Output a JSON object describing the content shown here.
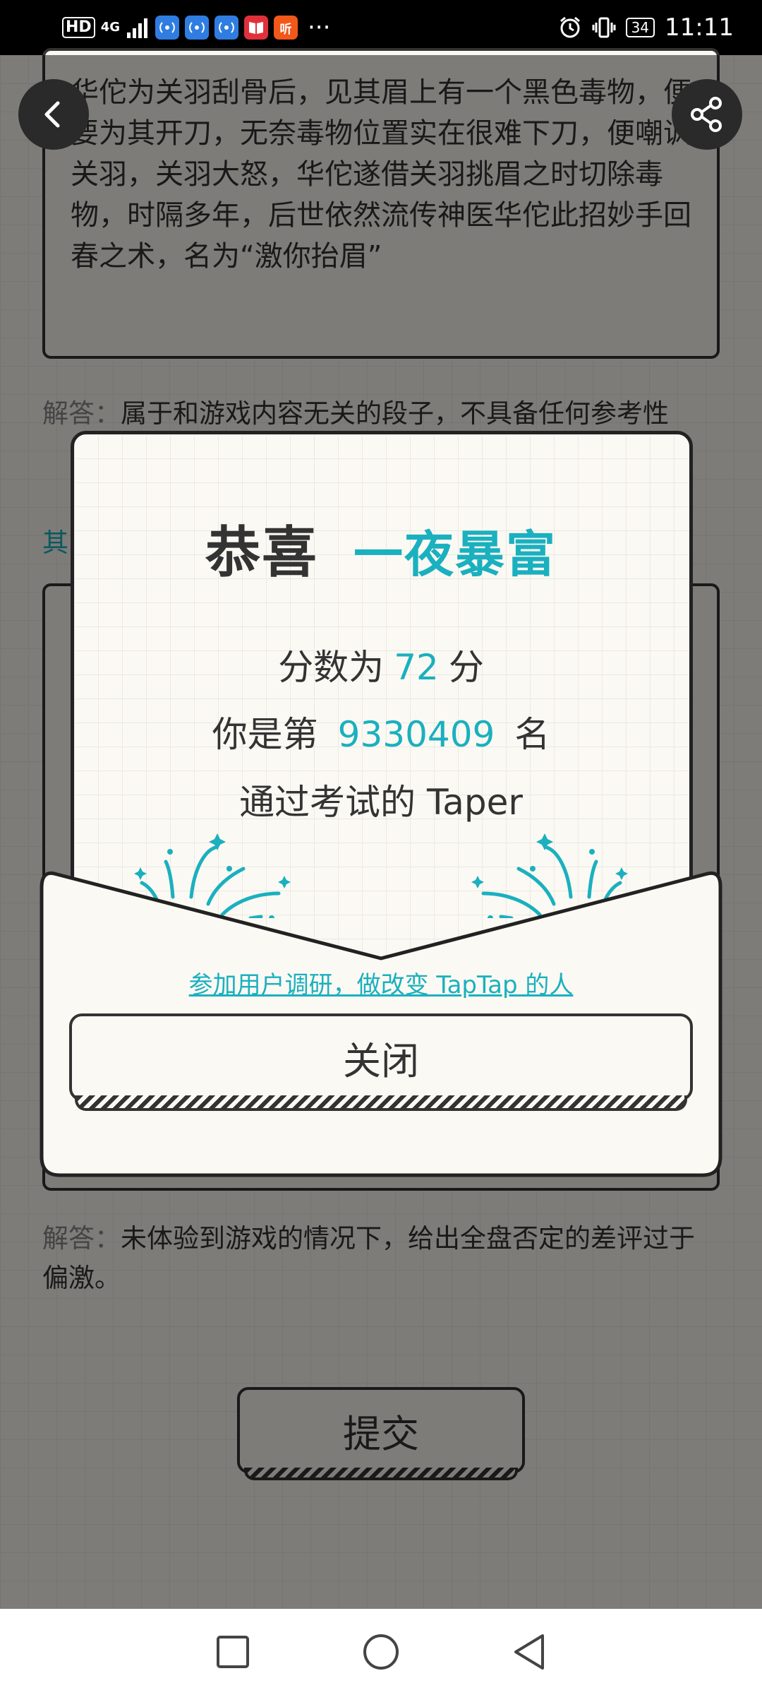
{
  "status_bar": {
    "hd": "HD",
    "network": "4G",
    "apps": [
      {
        "icon": "wifi-hotspot-icon",
        "glyph": "((·))",
        "color": "#2f7de1"
      },
      {
        "icon": "wifi-hotspot-icon",
        "glyph": "((·))",
        "color": "#2f7de1"
      },
      {
        "icon": "wifi-hotspot-icon",
        "glyph": "((·))",
        "color": "#2f7de1"
      },
      {
        "icon": "book-app-icon",
        "glyph": "▉",
        "color": "#e0313a"
      },
      {
        "icon": "listen-app-icon",
        "glyph": "听",
        "color": "#f1581a"
      }
    ],
    "more": "···",
    "battery": "34",
    "time": "11:11"
  },
  "page": {
    "story_text": "华佗为关羽刮骨后，见其眉上有一个黑色毒物，便要为其开刀，无奈毒物位置实在很难下刀，便嘲讽关羽，关羽大怒，华佗遂借关羽挑眉之时切除毒物，时隔多年，后世依然流传神医华佗此招妙手回春之术，名为“激你抬眉”",
    "answer1_label": "解答：",
    "answer1_text": "属于和游戏内容无关的段子，不具备任何参考性",
    "other_link": "其",
    "answer2_label": "解答：",
    "answer2_text": "未体验到游戏的情况下，给出全盘否定的差评过于偏激。",
    "submit_label": "提交"
  },
  "modal": {
    "title_prefix": "恭喜",
    "title_rank": "一夜暴富",
    "score_prefix": "分数为",
    "score_value": "72",
    "score_suffix": "分",
    "rank_prefix": "你是第",
    "rank_value": "9330409",
    "rank_suffix": "名",
    "passed_text": "通过考试的 Taper",
    "survey_link": "参加用户调研，做改变 TapTap 的人",
    "close_label": "关闭"
  },
  "colors": {
    "accent": "#1ab0bf",
    "text": "#333333",
    "paper": "#fbf9f3"
  }
}
